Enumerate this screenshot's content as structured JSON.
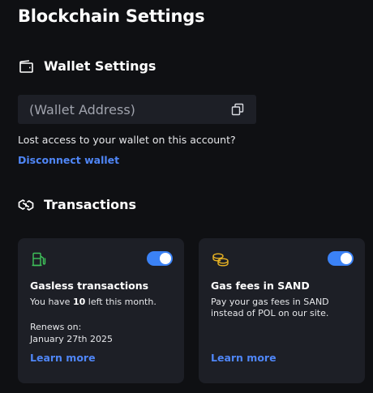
{
  "page": {
    "title": "Blockchain Settings"
  },
  "wallet_section": {
    "title": "Wallet Settings",
    "icon": "wallet-icon",
    "address_placeholder": "(Wallet Address)",
    "lost_access_text": "Lost access to your wallet on this account?",
    "disconnect_label": "Disconnect wallet"
  },
  "transactions_section": {
    "title": "Transactions",
    "icon": "chain-link-icon",
    "cards": [
      {
        "icon": "gas-pump-icon",
        "icon_color": "#3fc25a",
        "title": "Gasless transactions",
        "desc_prefix": "You have ",
        "desc_count": "10",
        "desc_suffix": " left this month.",
        "renews_label": "Renews on:",
        "renews_date": "January 27th 2025",
        "toggle_on": true,
        "learn_more": "Learn more"
      },
      {
        "icon": "coins-icon",
        "icon_color": "#e8b323",
        "title": "Gas fees in SAND",
        "desc": "Pay your gas fees in SAND instead of POL on our site.",
        "toggle_on": true,
        "learn_more": "Learn more"
      }
    ]
  },
  "colors": {
    "background": "#0f1013",
    "card": "#1d1f26",
    "accent": "#3b82f6",
    "link": "#4f86f7"
  }
}
